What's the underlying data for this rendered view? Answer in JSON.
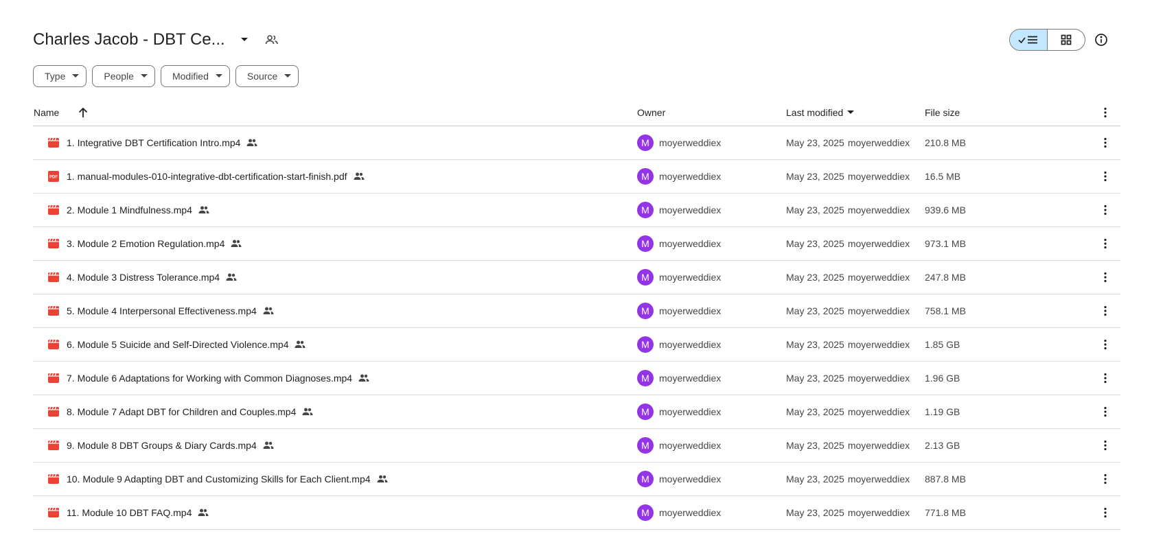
{
  "header": {
    "title": "Charles Jacob - DBT Ce...",
    "view_list_icon": "check-list-icon",
    "view_grid_icon": "grid-icon",
    "info_icon": "info-icon"
  },
  "filters": [
    {
      "label": "Type"
    },
    {
      "label": "People"
    },
    {
      "label": "Modified"
    },
    {
      "label": "Source"
    }
  ],
  "columns": {
    "name": "Name",
    "owner": "Owner",
    "last_modified": "Last modified",
    "file_size": "File size"
  },
  "colors": {
    "video_icon": "#ea4335",
    "pdf_icon": "#ea4335",
    "avatar": "#9334e6",
    "toggle_active": "#c2e7ff"
  },
  "files": [
    {
      "type": "video",
      "name": "1. Integrative DBT Certification  Intro.mp4",
      "owner_initial": "M",
      "owner": "moyerweddiex",
      "date": "May 23, 2025",
      "modified_by": "moyerweddiex",
      "size": "210.8 MB"
    },
    {
      "type": "pdf",
      "name": "1. manual-modules-010-integrative-dbt-certification-start-finish.pdf",
      "owner_initial": "M",
      "owner": "moyerweddiex",
      "date": "May 23, 2025",
      "modified_by": "moyerweddiex",
      "size": "16.5 MB"
    },
    {
      "type": "video",
      "name": "2. Module 1 Mindfulness.mp4",
      "owner_initial": "M",
      "owner": "moyerweddiex",
      "date": "May 23, 2025",
      "modified_by": "moyerweddiex",
      "size": "939.6 MB"
    },
    {
      "type": "video",
      "name": "3. Module 2 Emotion Regulation.mp4",
      "owner_initial": "M",
      "owner": "moyerweddiex",
      "date": "May 23, 2025",
      "modified_by": "moyerweddiex",
      "size": "973.1 MB"
    },
    {
      "type": "video",
      "name": "4. Module 3 Distress Tolerance.mp4",
      "owner_initial": "M",
      "owner": "moyerweddiex",
      "date": "May 23, 2025",
      "modified_by": "moyerweddiex",
      "size": "247.8 MB"
    },
    {
      "type": "video",
      "name": "5. Module 4 Interpersonal Effectiveness.mp4",
      "owner_initial": "M",
      "owner": "moyerweddiex",
      "date": "May 23, 2025",
      "modified_by": "moyerweddiex",
      "size": "758.1 MB"
    },
    {
      "type": "video",
      "name": "6. Module 5 Suicide and Self-Directed Violence.mp4",
      "owner_initial": "M",
      "owner": "moyerweddiex",
      "date": "May 23, 2025",
      "modified_by": "moyerweddiex",
      "size": "1.85 GB"
    },
    {
      "type": "video",
      "name": "7. Module 6 Adaptations for Working with Common Diagnoses.mp4",
      "owner_initial": "M",
      "owner": "moyerweddiex",
      "date": "May 23, 2025",
      "modified_by": "moyerweddiex",
      "size": "1.96 GB"
    },
    {
      "type": "video",
      "name": "8. Module 7 Adapt DBT for Children and Couples.mp4",
      "owner_initial": "M",
      "owner": "moyerweddiex",
      "date": "May 23, 2025",
      "modified_by": "moyerweddiex",
      "size": "1.19 GB"
    },
    {
      "type": "video",
      "name": "9. Module 8 DBT Groups & Diary Cards.mp4",
      "owner_initial": "M",
      "owner": "moyerweddiex",
      "date": "May 23, 2025",
      "modified_by": "moyerweddiex",
      "size": "2.13 GB"
    },
    {
      "type": "video",
      "name": "10. Module 9 Adapting DBT and Customizing Skills for Each Client.mp4",
      "owner_initial": "M",
      "owner": "moyerweddiex",
      "date": "May 23, 2025",
      "modified_by": "moyerweddiex",
      "size": "887.8 MB"
    },
    {
      "type": "video",
      "name": "11. Module 10 DBT FAQ.mp4",
      "owner_initial": "M",
      "owner": "moyerweddiex",
      "date": "May 23, 2025",
      "modified_by": "moyerweddiex",
      "size": "771.8 MB"
    }
  ]
}
